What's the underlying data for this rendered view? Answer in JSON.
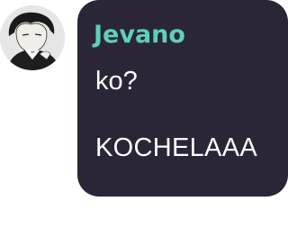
{
  "message": {
    "sender": "Jevano",
    "lines": [
      "ko?",
      "KOCHELAAA"
    ]
  },
  "colors": {
    "bubble_bg": "#2a2537",
    "sender_name": "#5fd0b8",
    "message_text": "#ffffff"
  },
  "avatar": {
    "icon": "profile-picture"
  }
}
